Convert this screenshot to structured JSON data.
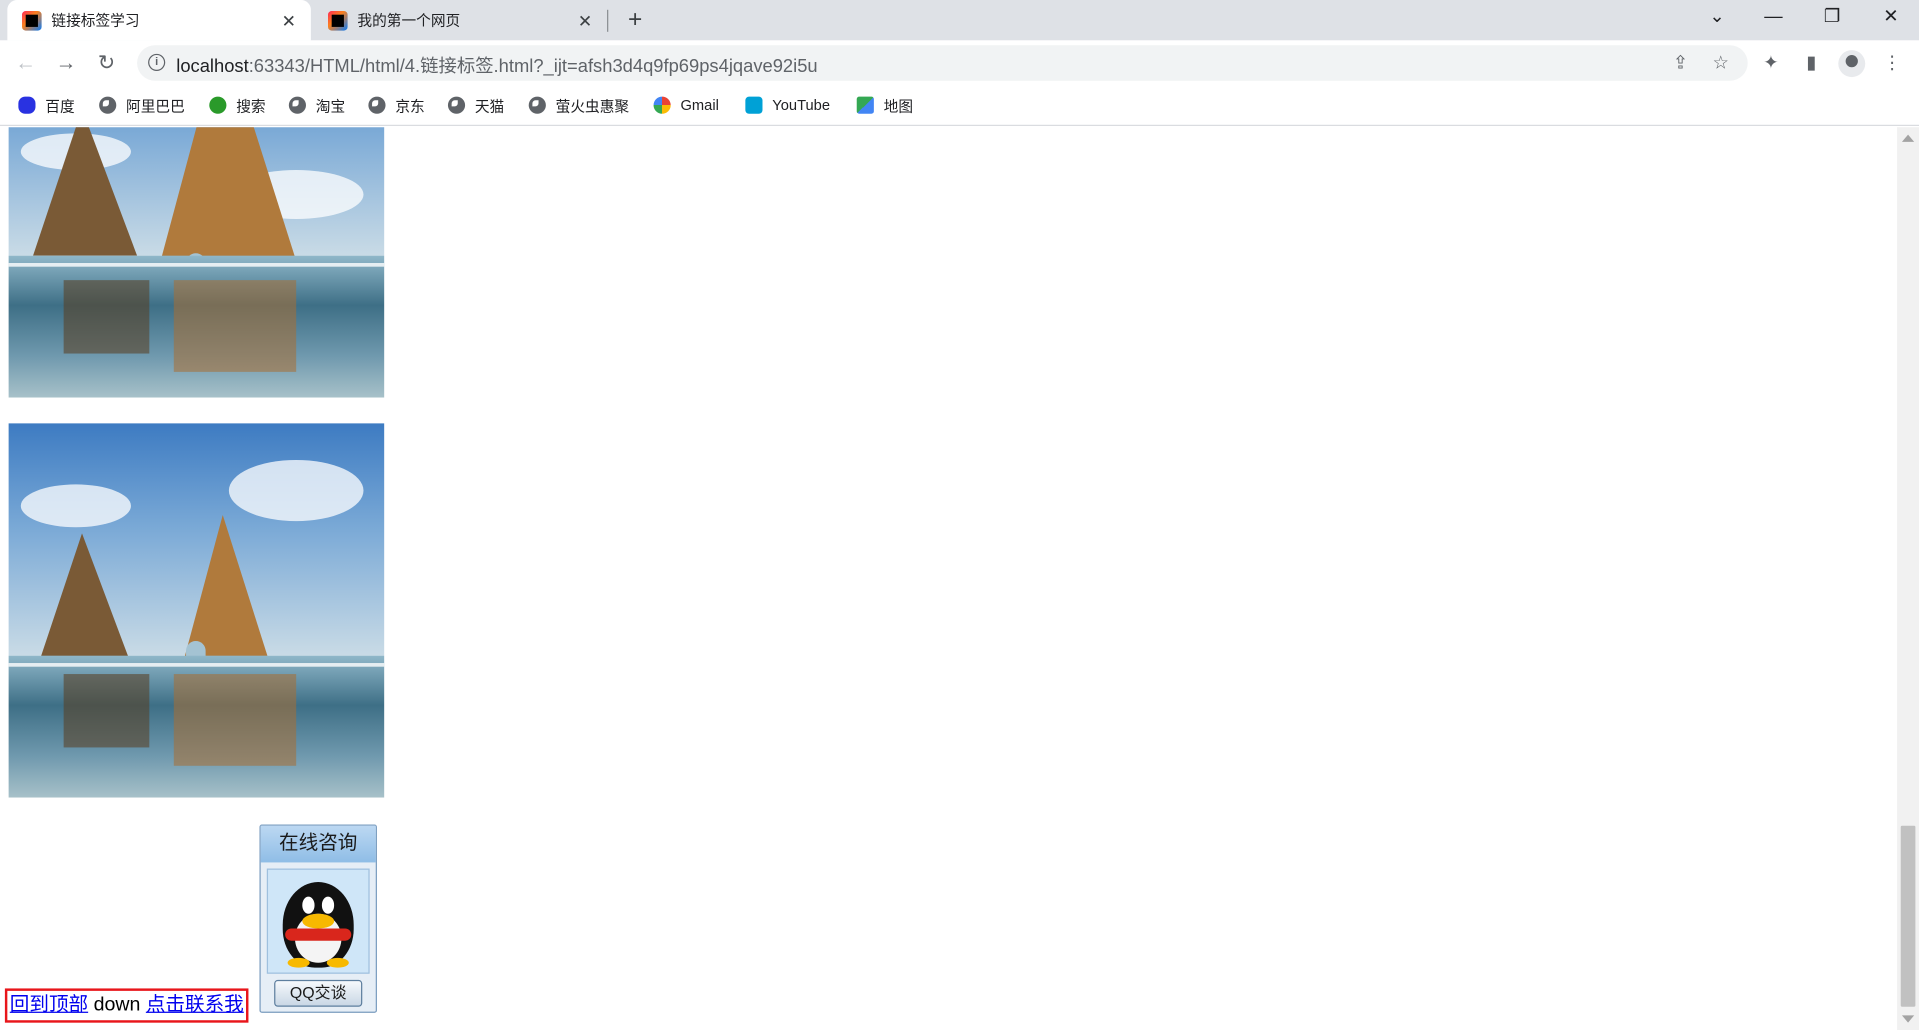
{
  "tabs": [
    {
      "label": "链接标签学习",
      "active": true
    },
    {
      "label": "我的第一个网页",
      "active": false
    }
  ],
  "toolbar": {
    "url_host": "localhost",
    "url_rest": ":63343/HTML/html/4.链接标签.html?_ijt=afsh3d4q9fp69ps4jqave92i5u"
  },
  "bookmarks": [
    {
      "label": "百度",
      "icon": "baidu-icon"
    },
    {
      "label": "阿里巴巴",
      "icon": "globe-icon"
    },
    {
      "label": "搜索",
      "icon": "search-engine-icon"
    },
    {
      "label": "淘宝",
      "icon": "globe-icon"
    },
    {
      "label": "京东",
      "icon": "globe-icon"
    },
    {
      "label": "天猫",
      "icon": "globe-icon"
    },
    {
      "label": "萤火虫惠聚",
      "icon": "globe-icon"
    },
    {
      "label": "Gmail",
      "icon": "gmail-icon"
    },
    {
      "label": "YouTube",
      "icon": "bilibili-tv-icon"
    },
    {
      "label": "地图",
      "icon": "maps-icon"
    }
  ],
  "page": {
    "qq_widget": {
      "title": "在线咨询",
      "button": "QQ交谈"
    },
    "links": {
      "back_to_top": "回到顶部",
      "down": "down",
      "contact": "点击联系我"
    }
  },
  "colors": {
    "link": "#0000ee",
    "highlight_border": "#e8161b",
    "tabbar_bg": "#dee1e6"
  }
}
